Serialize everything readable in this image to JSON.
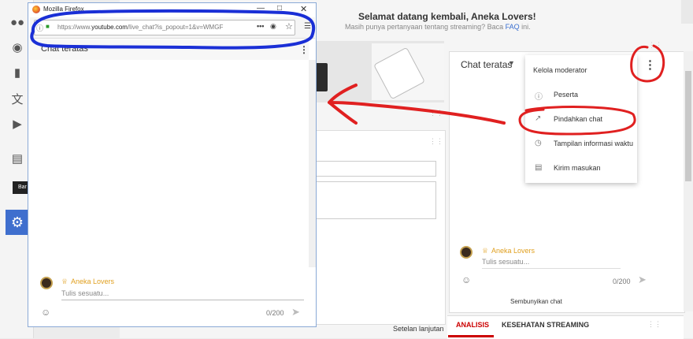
{
  "left_nav": {
    "icons": [
      "people-icon",
      "account-icon",
      "analytics-icon",
      "translate-icon",
      "video-icon",
      "subtitles-icon"
    ],
    "tooltip": "Bar",
    "settings_icon": "gear-icon"
  },
  "header": {
    "title": "Selamat datang kembali, Aneka Lovers!",
    "subtitle_prefix": "Masih punya pertanyaan tentang streaming? Baca ",
    "subtitle_link": "FAQ",
    "subtitle_suffix": " ini."
  },
  "main": {
    "advanced_settings": "Setelan lanjutan"
  },
  "right_chat": {
    "title": "Chat teratas",
    "user_name": "Aneka Lovers",
    "input_placeholder": "Tulis sesuatu...",
    "char_count": "0/200",
    "hide_chat": "Sembunyikan chat"
  },
  "menu": {
    "items": [
      {
        "label": "Kelola moderator",
        "icon": ""
      },
      {
        "label": "Peserta",
        "icon": "info-icon"
      },
      {
        "label": "Pindahkan chat",
        "icon": "popout-icon"
      },
      {
        "label": "Tampilan informasi waktu",
        "icon": "clock-icon"
      },
      {
        "label": "Kirim masukan",
        "icon": "feedback-icon"
      }
    ]
  },
  "tabs": [
    {
      "label": "ANALISIS",
      "active": true
    },
    {
      "label": "KESEHATAN STREAMING",
      "active": false
    }
  ],
  "firefox": {
    "window_title": "Mozilla Firefox",
    "url_prefix": "https://www.",
    "url_domain": "youtube.com",
    "url_suffix": "/live_chat?is_popout=1&v=WMGF",
    "chat_title": "Chat teratas",
    "user_name": "Aneka Lovers",
    "input_placeholder": "Tulis sesuatu...",
    "char_count": "0/200"
  },
  "colors": {
    "accent_blue": "#3f6fce",
    "annotation_red": "#e02020",
    "annotation_blue": "#1a2fd6",
    "tab_active": "#cc0000"
  }
}
